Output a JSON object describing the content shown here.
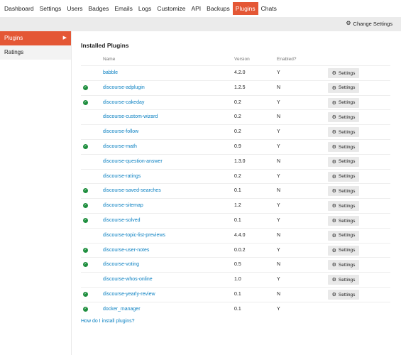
{
  "topnav": {
    "items": [
      "Dashboard",
      "Settings",
      "Users",
      "Badges",
      "Emails",
      "Logs",
      "Customize",
      "API",
      "Backups",
      "Plugins",
      "Chats"
    ],
    "active_index": 9
  },
  "subbar": {
    "change_settings_label": "Change Settings"
  },
  "sidebar": {
    "items": [
      {
        "label": "Plugins",
        "active": true
      },
      {
        "label": "Ratings",
        "active": false
      }
    ]
  },
  "main": {
    "title": "Installed Plugins",
    "columns": {
      "name": "Name",
      "version": "Version",
      "enabled": "Enabled?"
    },
    "settings_label": "Settings",
    "plugins": [
      {
        "name": "babble",
        "version": "4.2.0",
        "enabled": "Y",
        "check": false,
        "settings": true
      },
      {
        "name": "discourse-adplugin",
        "version": "1.2.5",
        "enabled": "N",
        "check": true,
        "settings": true
      },
      {
        "name": "discourse-cakeday",
        "version": "0.2",
        "enabled": "Y",
        "check": true,
        "settings": true
      },
      {
        "name": "discourse-custom-wizard",
        "version": "0.2",
        "enabled": "N",
        "check": false,
        "settings": true
      },
      {
        "name": "discourse-follow",
        "version": "0.2",
        "enabled": "Y",
        "check": false,
        "settings": true
      },
      {
        "name": "discourse-math",
        "version": "0.9",
        "enabled": "Y",
        "check": true,
        "settings": true
      },
      {
        "name": "discourse-question-answer",
        "version": "1.3.0",
        "enabled": "N",
        "check": false,
        "settings": true
      },
      {
        "name": "discourse-ratings",
        "version": "0.2",
        "enabled": "Y",
        "check": false,
        "settings": true
      },
      {
        "name": "discourse-saved-searches",
        "version": "0.1",
        "enabled": "N",
        "check": true,
        "settings": true
      },
      {
        "name": "discourse-sitemap",
        "version": "1.2",
        "enabled": "Y",
        "check": true,
        "settings": true
      },
      {
        "name": "discourse-solved",
        "version": "0.1",
        "enabled": "Y",
        "check": true,
        "settings": true
      },
      {
        "name": "discourse-topic-list-previews",
        "version": "4.4.0",
        "enabled": "N",
        "check": false,
        "settings": true
      },
      {
        "name": "discourse-user-notes",
        "version": "0.0.2",
        "enabled": "Y",
        "check": true,
        "settings": true
      },
      {
        "name": "discourse-voting",
        "version": "0.5",
        "enabled": "N",
        "check": true,
        "settings": true
      },
      {
        "name": "discourse-whos-online",
        "version": "1.0",
        "enabled": "Y",
        "check": false,
        "settings": true
      },
      {
        "name": "discourse-yearly-review",
        "version": "0.1",
        "enabled": "N",
        "check": true,
        "settings": true
      },
      {
        "name": "docker_manager",
        "version": "0.1",
        "enabled": "Y",
        "check": true,
        "settings": false
      }
    ],
    "help_link": "How do I install plugins?"
  },
  "icons": {
    "gear": "gear-icon",
    "check": "check-circle-icon",
    "caret": "caret-right-icon"
  },
  "colors": {
    "accent": "#e45735",
    "link": "#0a80c2",
    "check": "#1e8e3e"
  }
}
